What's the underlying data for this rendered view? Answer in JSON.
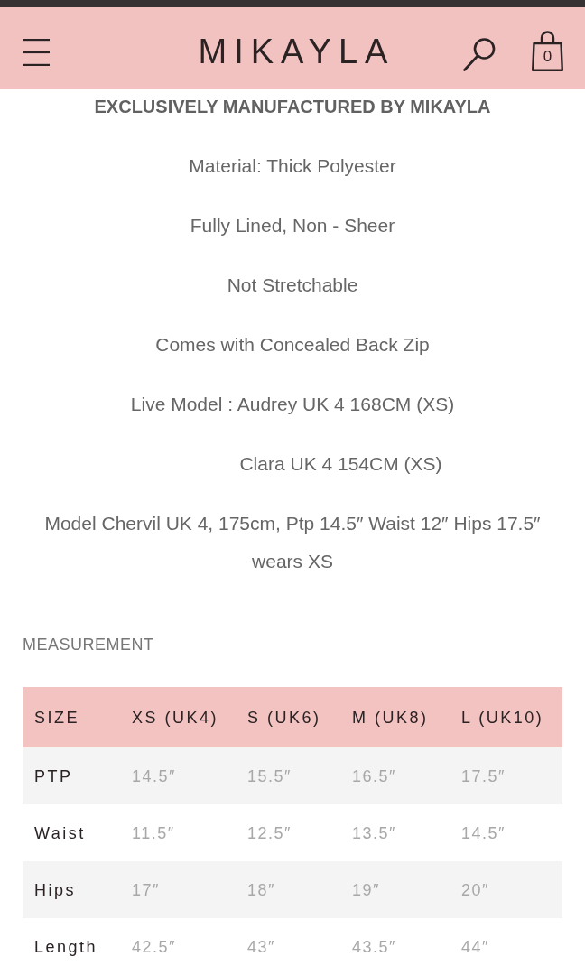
{
  "header": {
    "logo": "MIKAYLA",
    "cart_count": "0"
  },
  "details": {
    "heading": "EXCLUSIVELY MANUFACTURED BY MIKAYLA",
    "lines": [
      {
        "kind": "line",
        "text": "Material: Thick Polyester"
      },
      {
        "kind": "line",
        "text": "Fully Lined, Non - Sheer"
      },
      {
        "kind": "line",
        "text": "Not Stretchable"
      },
      {
        "kind": "line",
        "text": "Comes with Concealed Back Zip"
      },
      {
        "kind": "line",
        "text": "Live Model : Audrey UK 4 168CM (XS)"
      },
      {
        "kind": "continuation",
        "text": "Clara UK 4 154CM (XS)"
      },
      {
        "kind": "line",
        "text": "Model Chervil UK 4, 175cm, Ptp 14.5″ Waist 12″ Hips 17.5″ wears XS"
      }
    ]
  },
  "measurement": {
    "title": "MEASUREMENT",
    "table": {
      "columns": [
        "SIZE",
        "XS (UK4)",
        "S (UK6)",
        "M (UK8)",
        "L (UK10)"
      ],
      "rows": [
        {
          "label": "PTP",
          "values": [
            "14.5″",
            "15.5″",
            "16.5″",
            "17.5″"
          ]
        },
        {
          "label": "Waist",
          "values": [
            "11.5″",
            "12.5″",
            "13.5″",
            "14.5″"
          ]
        },
        {
          "label": "Hips",
          "values": [
            "17″",
            "18″",
            "19″",
            "20″"
          ]
        },
        {
          "label": "Length",
          "values": [
            "42.5″",
            "43″",
            "43.5″",
            "44″"
          ]
        }
      ]
    }
  }
}
